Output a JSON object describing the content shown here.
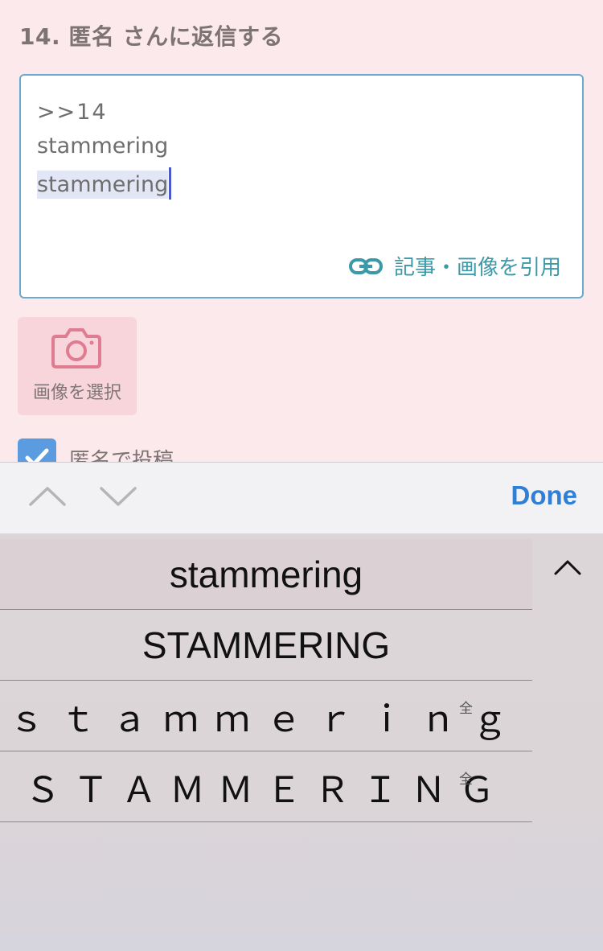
{
  "reply": {
    "title": "14. 匿名 さんに返信する",
    "text_lines": [
      ">>14",
      "stammering",
      "stammering"
    ],
    "quote_link_label": "記事・画像を引用",
    "image_select_label": "画像を選択",
    "anonymous_label": "匿名で投稿",
    "anonymous_checked": true
  },
  "keyboard": {
    "done_label": "Done",
    "candidates": [
      {
        "text": "stammering",
        "badge": ""
      },
      {
        "text": "STAMMERING",
        "badge": ""
      },
      {
        "text": "ｓｔａｍｍｅｒｉｎｇ",
        "badge": "全"
      },
      {
        "text": "ＳＴＡＭＭＥＲＩＮＧ",
        "badge": "全"
      }
    ]
  },
  "colors": {
    "background": "#fbe9ec",
    "textbox_border": "#6aaad0",
    "link": "#3c9aa8",
    "done": "#2f7fd6",
    "checkbox": "#5b9be0",
    "camera": "#e07c92"
  },
  "icons": {
    "link": "link-icon",
    "camera": "camera-icon",
    "check": "check-icon",
    "up": "chevron-up-icon",
    "down": "chevron-down-icon"
  }
}
